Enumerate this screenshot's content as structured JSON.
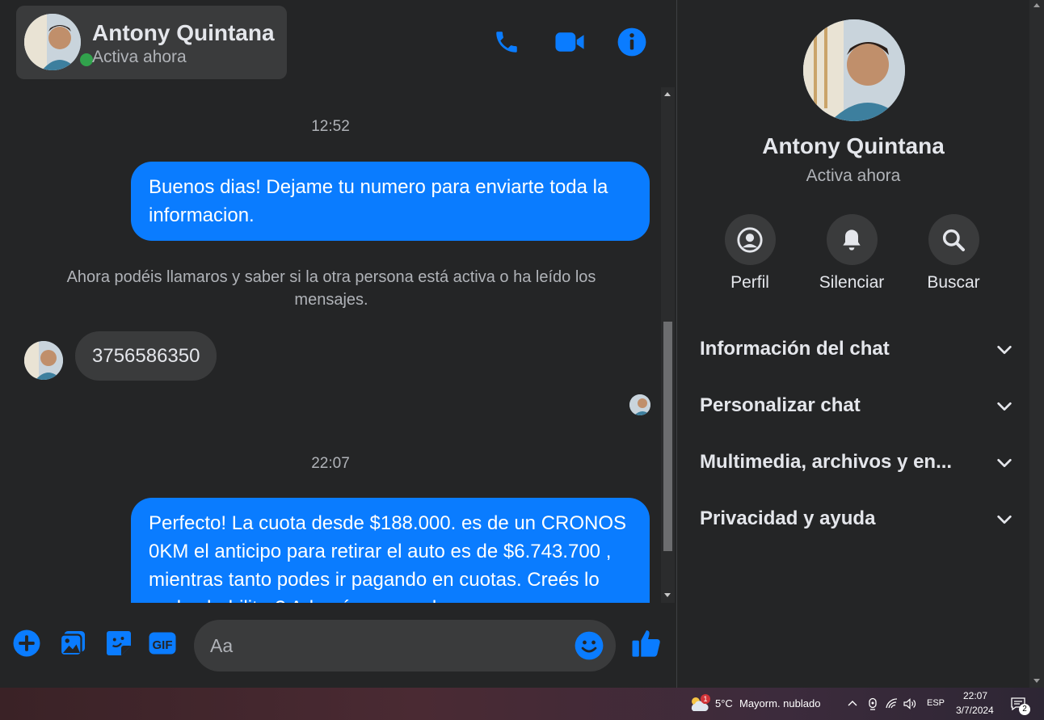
{
  "header": {
    "contact_name": "Antony Quintana",
    "contact_status": "Activa ahora"
  },
  "messages": {
    "timestamp_1": "12:52",
    "outgoing_1": "Buenos dias! Dejame tu numero para enviarte toda la informacion.",
    "notice": "Ahora podéis llamaros y saber si la otra persona está activa o ha leído los mensajes.",
    "incoming_1": "3756586350",
    "timestamp_2": "22:07",
    "outgoing_2": "Perfecto! La cuota desde $188.000. es de un CRONOS 0KM el anticipo para retirar el auto es de $6.743.700 , mientras tanto podes ir pagando en cuotas. Creés lo podes habilitar? Además, ¿cuando"
  },
  "composer": {
    "placeholder": "Aa"
  },
  "info": {
    "name": "Antony Quintana",
    "status": "Activa ahora",
    "actions": [
      {
        "label": "Perfil",
        "icon": "profile-icon"
      },
      {
        "label": "Silenciar",
        "icon": "bell-icon"
      },
      {
        "label": "Buscar",
        "icon": "search-icon"
      }
    ],
    "sections": [
      {
        "label": "Información del chat"
      },
      {
        "label": "Personalizar chat"
      },
      {
        "label": "Multimedia, archivos y en..."
      },
      {
        "label": "Privacidad y ayuda"
      }
    ]
  },
  "taskbar": {
    "weather_temp": "5°C",
    "weather_desc": "Mayorm. nublado",
    "weather_badge": "1",
    "language": "ESP",
    "time": "22:07",
    "date": "3/7/2024",
    "notification_count": "2"
  },
  "colors": {
    "accent": "#0a7cff",
    "background": "#242526",
    "surface": "#3a3b3c",
    "online": "#31a24c"
  }
}
